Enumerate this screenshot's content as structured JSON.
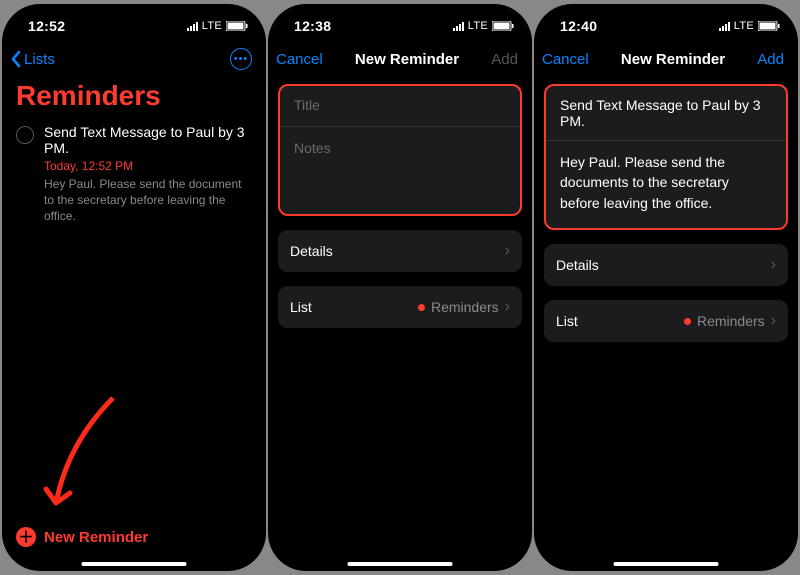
{
  "colors": {
    "accent_blue": "#0a84ff",
    "accent_red": "#ff3b30",
    "bg": "#000000"
  },
  "screen1": {
    "status": {
      "time": "12:52",
      "signal": "LTE"
    },
    "nav": {
      "back_label": "Lists"
    },
    "title": "Reminders",
    "reminder": {
      "title": "Send Text Message to Paul by 3 PM.",
      "due": "Today, 12:52 PM",
      "notes": "Hey Paul. Please send the document to the secretary before leaving the office."
    },
    "new_reminder_label": "New Reminder"
  },
  "screen2": {
    "status": {
      "time": "12:38",
      "signal": "LTE"
    },
    "nav": {
      "cancel": "Cancel",
      "title": "New Reminder",
      "add": "Add"
    },
    "title_placeholder": "Title",
    "notes_placeholder": "Notes",
    "details_label": "Details",
    "list_label": "List",
    "list_value": "Reminders"
  },
  "screen3": {
    "status": {
      "time": "12:40",
      "signal": "LTE"
    },
    "nav": {
      "cancel": "Cancel",
      "title": "New Reminder",
      "add": "Add"
    },
    "title_value": "Send Text Message to Paul by 3 PM.",
    "notes_value": "Hey Paul. Please send the documents to the secretary before leaving the office.",
    "details_label": "Details",
    "list_label": "List",
    "list_value": "Reminders"
  }
}
